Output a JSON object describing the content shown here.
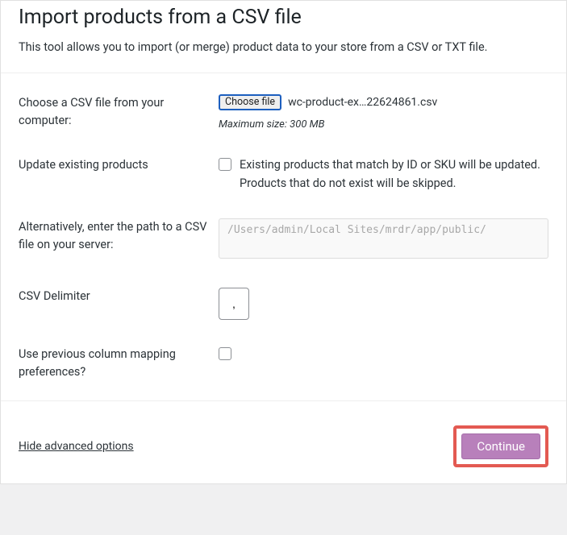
{
  "header": {
    "title": "Import products from a CSV file",
    "subtitle": "This tool allows you to import (or merge) product data to your store from a CSV or TXT file."
  },
  "form": {
    "chooseFile": {
      "label": "Choose a CSV file from your computer:",
      "button": "Choose file",
      "filename": "wc-product-ex…22624861.csv",
      "hint": "Maximum size: 300 MB"
    },
    "updateExisting": {
      "label": "Update existing products",
      "description": "Existing products that match by ID or SKU will be updated. Products that do not exist will be skipped."
    },
    "serverPath": {
      "label": "Alternatively, enter the path to a CSV file on your server:",
      "placeholder": "/Users/admin/Local Sites/mrdr/app/public/"
    },
    "delimiter": {
      "label": "CSV Delimiter",
      "value": ","
    },
    "previousMapping": {
      "label": "Use previous column mapping preferences?"
    }
  },
  "footer": {
    "hideLink": "Hide advanced options",
    "continueButton": "Continue"
  }
}
